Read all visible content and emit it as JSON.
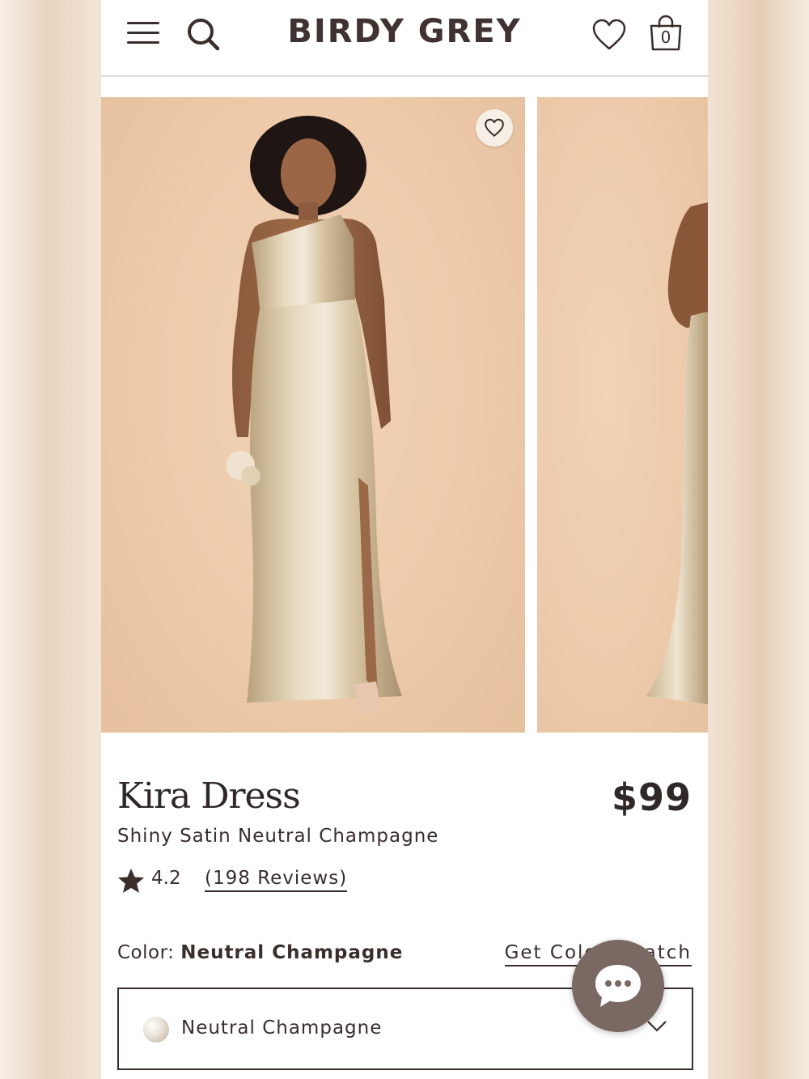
{
  "header": {
    "brand": "BIRDY GREY",
    "cart_count": "0",
    "icons": [
      "menu-icon",
      "search-icon",
      "heart-icon",
      "shopping-bag-icon"
    ]
  },
  "gallery": {
    "images": [
      {
        "alt": "Model wearing one-shoulder shiny satin gown in neutral champagne, front view"
      },
      {
        "alt": "Model wearing satin gown, side view (partially visible)"
      }
    ]
  },
  "product": {
    "title": "Kira Dress",
    "price": "$99",
    "subtitle": "Shiny Satin Neutral Champagne",
    "rating": "4.2",
    "reviews_label": "(198 Reviews)"
  },
  "color": {
    "label_prefix": "Color:",
    "selected": "Neutral Champagne",
    "swatch_link": "Get Color Swatch",
    "dropdown_value": "Neutral Champagne"
  },
  "colors": {
    "text": "#3a2e2b",
    "backdrop": "#ecc9a9",
    "dress": "#d9c6a5",
    "chat_button": "#7a6863"
  }
}
